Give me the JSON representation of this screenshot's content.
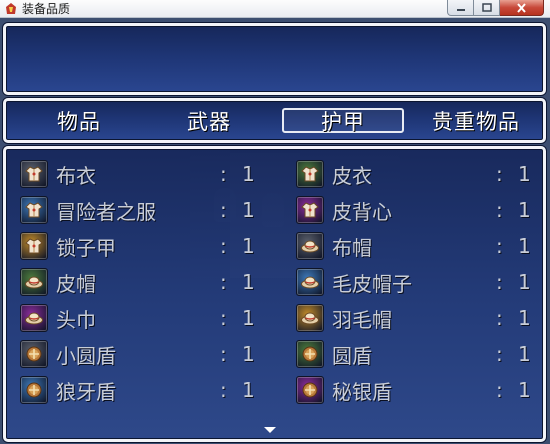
{
  "window": {
    "title": "装备品质"
  },
  "help_text": "",
  "categories": [
    {
      "label": "物品",
      "selected": false
    },
    {
      "label": "武器",
      "selected": false
    },
    {
      "label": "护甲",
      "selected": true
    },
    {
      "label": "贵重物品",
      "selected": false
    }
  ],
  "items": [
    {
      "name": "布衣",
      "colon": ":",
      "count": "1",
      "icon": "cloth-armor-icon",
      "frame_color": "#5a5f6b"
    },
    {
      "name": "皮衣",
      "colon": ":",
      "count": "1",
      "icon": "leather-armor-icon",
      "frame_color": "#4c7a3c"
    },
    {
      "name": "冒险者之服",
      "colon": ":",
      "count": "1",
      "icon": "adventurer-clothes-icon",
      "frame_color": "#3d78b8"
    },
    {
      "name": "皮背心",
      "colon": ":",
      "count": "1",
      "icon": "leather-vest-icon",
      "frame_color": "#8a2c9a"
    },
    {
      "name": "锁子甲",
      "colon": ":",
      "count": "1",
      "icon": "chainmail-icon",
      "frame_color": "#c08a2a"
    },
    {
      "name": "布帽",
      "colon": ":",
      "count": "1",
      "icon": "cloth-hat-icon",
      "frame_color": "#5a5f6b"
    },
    {
      "name": "皮帽",
      "colon": ":",
      "count": "1",
      "icon": "leather-hat-icon",
      "frame_color": "#4c7a3c"
    },
    {
      "name": "毛皮帽子",
      "colon": ":",
      "count": "1",
      "icon": "fur-hat-icon",
      "frame_color": "#3d78b8"
    },
    {
      "name": "头巾",
      "colon": ":",
      "count": "1",
      "icon": "bandana-icon",
      "frame_color": "#8a2c9a"
    },
    {
      "name": "羽毛帽",
      "colon": ":",
      "count": "1",
      "icon": "feather-hat-icon",
      "frame_color": "#c08a2a"
    },
    {
      "name": "小圆盾",
      "colon": ":",
      "count": "1",
      "icon": "small-round-shield-icon",
      "frame_color": "#5a5f6b"
    },
    {
      "name": "圆盾",
      "colon": ":",
      "count": "1",
      "icon": "round-shield-icon",
      "frame_color": "#4c7a3c"
    },
    {
      "name": "狼牙盾",
      "colon": ":",
      "count": "1",
      "icon": "wolf-fang-shield-icon",
      "frame_color": "#3d78b8"
    },
    {
      "name": "秘银盾",
      "colon": ":",
      "count": "1",
      "icon": "mithril-shield-icon",
      "frame_color": "#8a2c9a"
    }
  ],
  "colors": {
    "window_border": "#f2f4f8",
    "window_bg_top": "#16275a",
    "window_bg_bottom": "#2a4690",
    "text": "#c9ced8",
    "tab_text": "#ffffff"
  }
}
